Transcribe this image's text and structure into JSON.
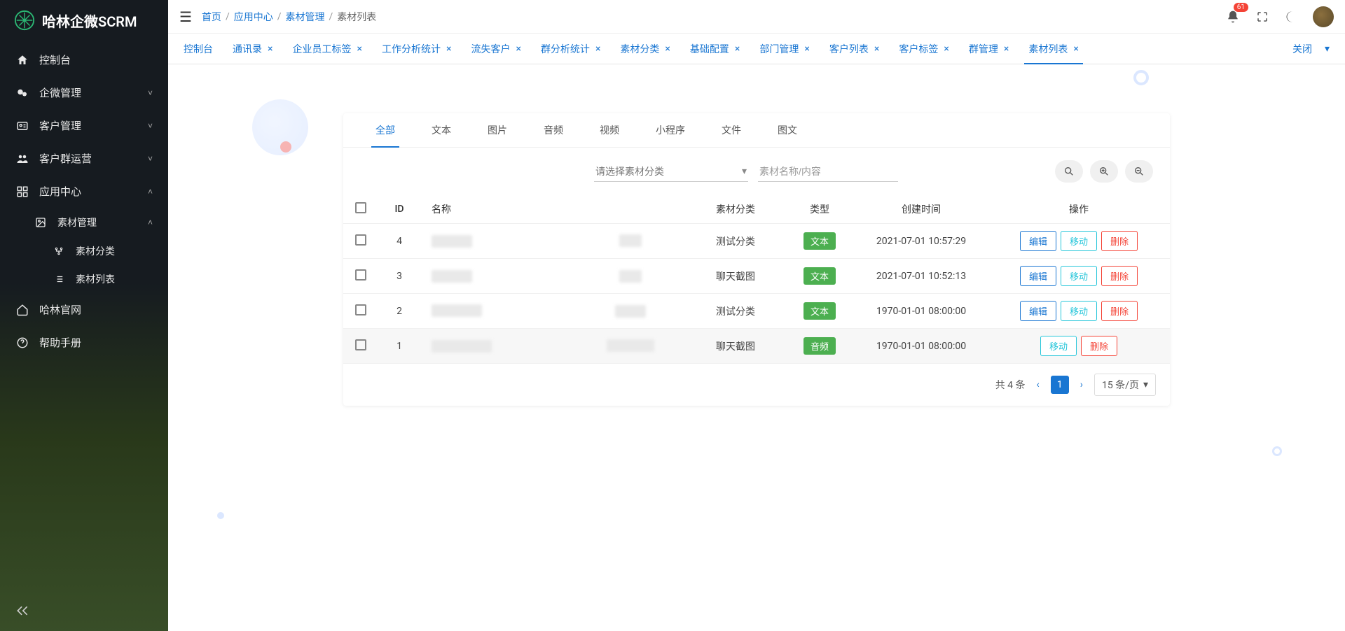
{
  "brand": {
    "title": "哈林企微SCRM"
  },
  "sidebar": {
    "items": [
      {
        "label": "控制台",
        "icon": "home",
        "hasArrow": false
      },
      {
        "label": "企微管理",
        "icon": "wechat",
        "hasArrow": true,
        "expanded": false
      },
      {
        "label": "客户管理",
        "icon": "id-card",
        "hasArrow": true,
        "expanded": false
      },
      {
        "label": "客户群运营",
        "icon": "group",
        "hasArrow": true,
        "expanded": false
      },
      {
        "label": "应用中心",
        "icon": "apps",
        "hasArrow": true,
        "expanded": true,
        "children": [
          {
            "label": "素材管理",
            "icon": "image",
            "hasArrow": true,
            "expanded": true,
            "children": [
              {
                "label": "素材分类",
                "icon": "branch"
              },
              {
                "label": "素材列表",
                "icon": "list"
              }
            ]
          }
        ]
      },
      {
        "label": "哈林官网",
        "icon": "home-outline",
        "hasArrow": false
      },
      {
        "label": "帮助手册",
        "icon": "help",
        "hasArrow": false
      }
    ]
  },
  "topbar": {
    "breadcrumb": [
      "首页",
      "应用中心",
      "素材管理",
      "素材列表"
    ],
    "notificationCount": "61"
  },
  "tabs": {
    "items": [
      {
        "label": "控制台",
        "closable": false
      },
      {
        "label": "通讯录",
        "closable": true
      },
      {
        "label": "企业员工标签",
        "closable": true
      },
      {
        "label": "工作分析统计",
        "closable": true
      },
      {
        "label": "流失客户",
        "closable": true
      },
      {
        "label": "群分析统计",
        "closable": true
      },
      {
        "label": "素材分类",
        "closable": true
      },
      {
        "label": "基础配置",
        "closable": true
      },
      {
        "label": "部门管理",
        "closable": true
      },
      {
        "label": "客户列表",
        "closable": true
      },
      {
        "label": "客户标签",
        "closable": true
      },
      {
        "label": "群管理",
        "closable": true
      },
      {
        "label": "素材列表",
        "closable": true,
        "active": true
      }
    ],
    "closeLabel": "关闭"
  },
  "innerTabs": [
    "全部",
    "文本",
    "图片",
    "音频",
    "视频",
    "小程序",
    "文件",
    "图文"
  ],
  "filters": {
    "categoryPlaceholder": "请选择素材分类",
    "searchPlaceholder": "素材名称/内容"
  },
  "table": {
    "headers": {
      "id": "ID",
      "name": "名称",
      "content": "",
      "category": "素材分类",
      "type": "类型",
      "createdAt": "创建时间",
      "ops": "操作"
    },
    "rows": [
      {
        "id": "4",
        "nameMask": "xx",
        "contentMask": "式",
        "category": "测试分类",
        "type": "文本",
        "typeColor": "green",
        "createdAt": "2021-07-01 10:57:29",
        "ops": [
          "编辑",
          "移动",
          "删除"
        ]
      },
      {
        "id": "3",
        "nameMask": "xx",
        "contentMask": "x",
        "category": "聊天截图",
        "type": "文本",
        "typeColor": "green",
        "createdAt": "2021-07-01 10:52:13",
        "ops": [
          "编辑",
          "移动",
          "删除"
        ]
      },
      {
        "id": "2",
        "nameMask": "x 噫",
        "contentMask": "xx",
        "category": "测试分类",
        "type": "文本",
        "typeColor": "green",
        "createdAt": "1970-01-01 08:00:00",
        "ops": [
          "编辑",
          "移动",
          "删除"
        ]
      },
      {
        "id": "1",
        "nameMask": "xxxx",
        "contentMask": "啊啊 x",
        "category": "聊天截图",
        "type": "音频",
        "typeColor": "green",
        "createdAt": "1970-01-01 08:00:00",
        "ops": [
          "移动",
          "删除"
        ],
        "highlight": true
      }
    ],
    "opColors": {
      "编辑": "primary",
      "移动": "info",
      "删除": "danger"
    }
  },
  "pagination": {
    "totalLabel": "共 4 条",
    "current": "1",
    "pageSizeLabel": "15 条/页"
  }
}
